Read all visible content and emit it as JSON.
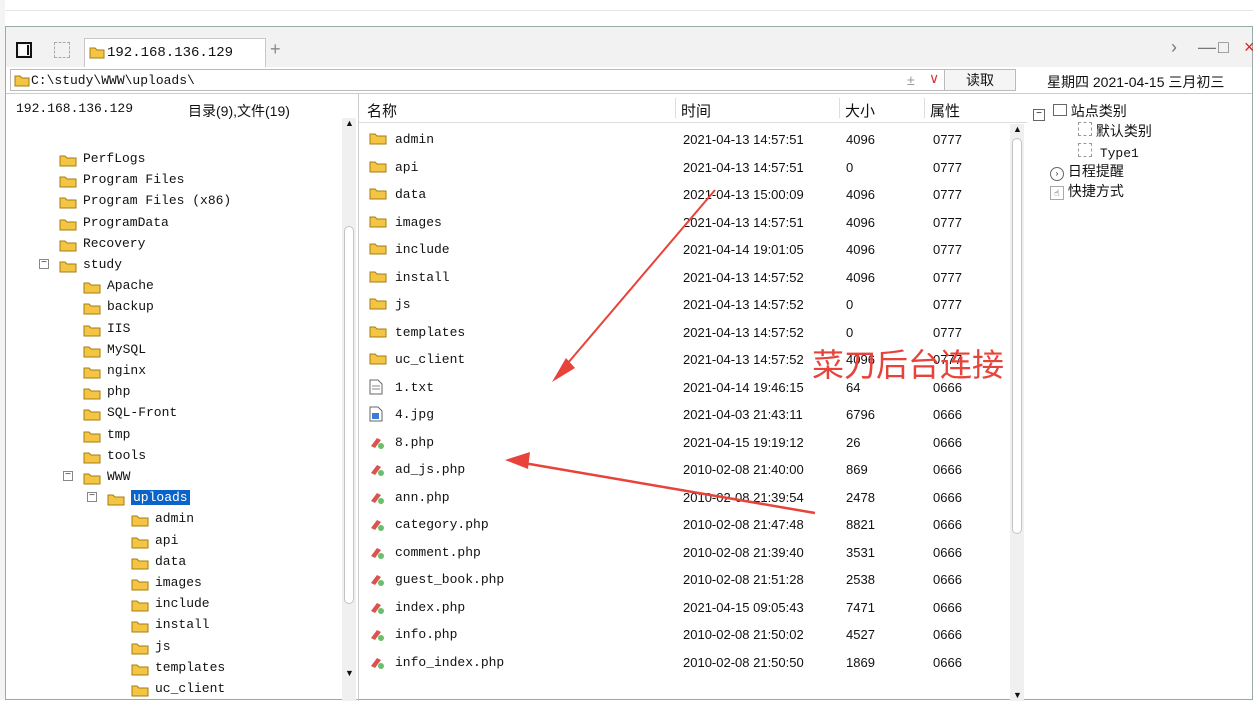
{
  "tab": {
    "label": "192.168.136.129"
  },
  "address": {
    "path": "C:\\study\\WWW\\uploads\\",
    "pm": "±",
    "read_label": "读取"
  },
  "date": "星期四 2021-04-15 三月初三",
  "tree": {
    "host": "192.168.136.129",
    "summary": "目录(9),文件(19)",
    "nodes": [
      {
        "label": "PerfLogs",
        "level": 0,
        "exp": ""
      },
      {
        "label": "Program Files",
        "level": 0,
        "exp": ""
      },
      {
        "label": "Program Files (x86)",
        "level": 0,
        "exp": ""
      },
      {
        "label": "ProgramData",
        "level": 0,
        "exp": ""
      },
      {
        "label": "Recovery",
        "level": 0,
        "exp": ""
      },
      {
        "label": "study",
        "level": 0,
        "exp": "−"
      },
      {
        "label": "Apache",
        "level": 1,
        "exp": ""
      },
      {
        "label": "backup",
        "level": 1,
        "exp": ""
      },
      {
        "label": "IIS",
        "level": 1,
        "exp": ""
      },
      {
        "label": "MySQL",
        "level": 1,
        "exp": ""
      },
      {
        "label": "nginx",
        "level": 1,
        "exp": ""
      },
      {
        "label": "php",
        "level": 1,
        "exp": ""
      },
      {
        "label": "SQL-Front",
        "level": 1,
        "exp": ""
      },
      {
        "label": "tmp",
        "level": 1,
        "exp": ""
      },
      {
        "label": "tools",
        "level": 1,
        "exp": ""
      },
      {
        "label": "WWW",
        "level": 1,
        "exp": "−"
      },
      {
        "label": "uploads",
        "level": 2,
        "exp": "−",
        "selected": true
      },
      {
        "label": "admin",
        "level": 3,
        "exp": ""
      },
      {
        "label": "api",
        "level": 3,
        "exp": ""
      },
      {
        "label": "data",
        "level": 3,
        "exp": ""
      },
      {
        "label": "images",
        "level": 3,
        "exp": ""
      },
      {
        "label": "include",
        "level": 3,
        "exp": ""
      },
      {
        "label": "install",
        "level": 3,
        "exp": ""
      },
      {
        "label": "js",
        "level": 3,
        "exp": ""
      },
      {
        "label": "templates",
        "level": 3,
        "exp": ""
      },
      {
        "label": "uc_client",
        "level": 3,
        "exp": ""
      }
    ]
  },
  "files": {
    "headers": {
      "name": "名称",
      "time": "时间",
      "size": "大小",
      "attr": "属性"
    },
    "rows": [
      {
        "name": "admin",
        "time": "2021-04-13 14:57:51",
        "size": "4096",
        "attr": "0777",
        "type": "folder"
      },
      {
        "name": "api",
        "time": "2021-04-13 14:57:51",
        "size": "0",
        "attr": "0777",
        "type": "folder"
      },
      {
        "name": "data",
        "time": "2021-04-13 15:00:09",
        "size": "4096",
        "attr": "0777",
        "type": "folder"
      },
      {
        "name": "images",
        "time": "2021-04-13 14:57:51",
        "size": "4096",
        "attr": "0777",
        "type": "folder"
      },
      {
        "name": "include",
        "time": "2021-04-14 19:01:05",
        "size": "4096",
        "attr": "0777",
        "type": "folder"
      },
      {
        "name": "install",
        "time": "2021-04-13 14:57:52",
        "size": "4096",
        "attr": "0777",
        "type": "folder"
      },
      {
        "name": "js",
        "time": "2021-04-13 14:57:52",
        "size": "0",
        "attr": "0777",
        "type": "folder"
      },
      {
        "name": "templates",
        "time": "2021-04-13 14:57:52",
        "size": "0",
        "attr": "0777",
        "type": "folder"
      },
      {
        "name": "uc_client",
        "time": "2021-04-13 14:57:52",
        "size": "4096",
        "attr": "0777",
        "type": "folder"
      },
      {
        "name": "1.txt",
        "time": "2021-04-14 19:46:15",
        "size": "64",
        "attr": "0666",
        "type": "txt"
      },
      {
        "name": "4.jpg",
        "time": "2021-04-03 21:43:11",
        "size": "6796",
        "attr": "0666",
        "type": "img"
      },
      {
        "name": "8.php",
        "time": "2021-04-15 19:19:12",
        "size": "26",
        "attr": "0666",
        "type": "php"
      },
      {
        "name": "ad_js.php",
        "time": "2010-02-08 21:40:00",
        "size": "869",
        "attr": "0666",
        "type": "php"
      },
      {
        "name": "ann.php",
        "time": "2010-02-08 21:39:54",
        "size": "2478",
        "attr": "0666",
        "type": "php"
      },
      {
        "name": "category.php",
        "time": "2010-02-08 21:47:48",
        "size": "8821",
        "attr": "0666",
        "type": "php"
      },
      {
        "name": "comment.php",
        "time": "2010-02-08 21:39:40",
        "size": "3531",
        "attr": "0666",
        "type": "php"
      },
      {
        "name": "guest_book.php",
        "time": "2010-02-08 21:51:28",
        "size": "2538",
        "attr": "0666",
        "type": "php"
      },
      {
        "name": "index.php",
        "time": "2021-04-15 09:05:43",
        "size": "7471",
        "attr": "0666",
        "type": "php"
      },
      {
        "name": "info.php",
        "time": "2010-02-08 21:50:02",
        "size": "4527",
        "attr": "0666",
        "type": "php"
      },
      {
        "name": "info_index.php",
        "time": "2010-02-08 21:50:50",
        "size": "1869",
        "attr": "0666",
        "type": "php"
      }
    ]
  },
  "right": {
    "site_cat": "站点类别",
    "default_cat": "默认类别",
    "type1": "Type1",
    "schedule": "日程提醒",
    "shortcut": "快捷方式"
  },
  "annotation": "菜刀后台连接",
  "colors": {
    "annotation": "#e8433a",
    "selection": "#0a63c9",
    "folder": "#f4c542"
  }
}
